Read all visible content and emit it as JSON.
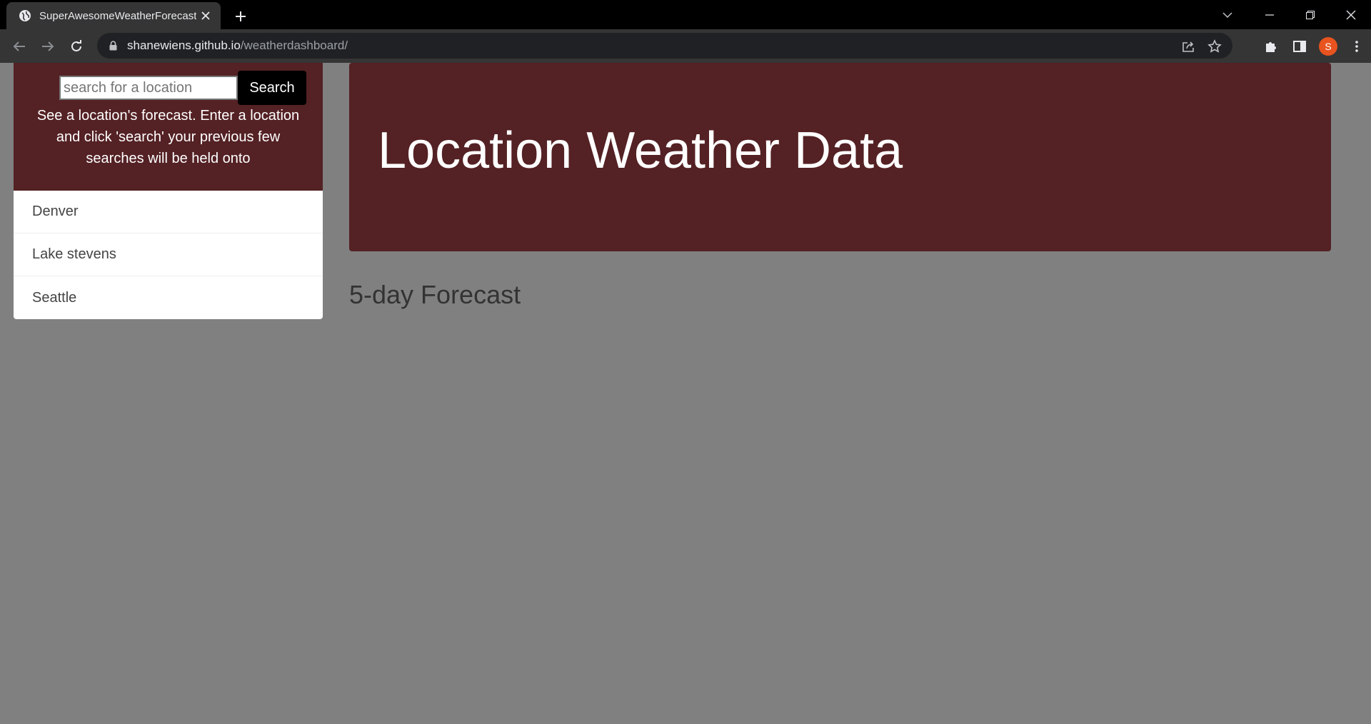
{
  "browser": {
    "tab_title": "SuperAwesomeWeatherForecast!",
    "url_host": "shanewiens.github.io",
    "url_path": "/weatherdashboard/",
    "profile_initial": "S",
    "profile_color": "#e8531f"
  },
  "search": {
    "placeholder": "search for a location",
    "value": "",
    "button_label": "Search",
    "instructions": "See a location's forecast. Enter a location and click 'search' your previous few searches will be held onto"
  },
  "history": [
    "Denver",
    "Lake stevens",
    "Seattle"
  ],
  "hero": {
    "title": "Location Weather Data"
  },
  "forecast": {
    "title": "5-day Forecast"
  },
  "colors": {
    "accent": "#542124",
    "page_background": "#808080"
  }
}
